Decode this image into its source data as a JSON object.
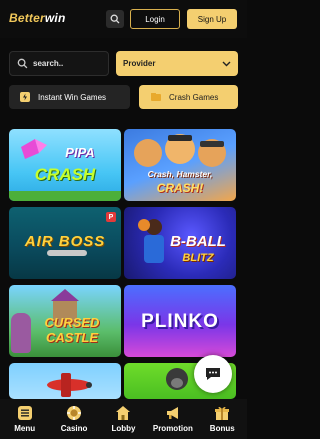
{
  "header": {
    "logo_part1": "Better",
    "logo_part2": "win",
    "login_label": "Login",
    "signup_label": "Sign Up"
  },
  "filters": {
    "search_placeholder": "search..",
    "provider_label": "Provider"
  },
  "categories": [
    {
      "label": "Instant Win Games",
      "active": false
    },
    {
      "label": "Crash Games",
      "active": true
    }
  ],
  "games": [
    {
      "title_line1": "PIPA",
      "title_line2": "CRASH"
    },
    {
      "title_line1": "Crash, Hamster,",
      "title_line2": "CRASH!"
    },
    {
      "title_line1": "AIR BOSS",
      "title_line2": "",
      "badge": "P"
    },
    {
      "title_line1": "B-BALL",
      "title_line2": "BLITZ"
    },
    {
      "title_line1": "CURSED",
      "title_line2": "CASTLE"
    },
    {
      "title_line1": "PLINKO",
      "title_line2": ""
    },
    {
      "title_line1": "",
      "title_line2": ""
    },
    {
      "title_line1": "",
      "title_line2": ""
    }
  ],
  "nav": [
    {
      "label": "Menu",
      "icon": "menu-icon"
    },
    {
      "label": "Casino",
      "icon": "casino-chip-icon"
    },
    {
      "label": "Lobby",
      "icon": "lobby-house-icon"
    },
    {
      "label": "Promotion",
      "icon": "megaphone-icon"
    },
    {
      "label": "Bonus",
      "icon": "gift-icon"
    }
  ],
  "colors": {
    "accent": "#f4cf70",
    "background": "#0b0b0b",
    "tab_inactive": "#242424"
  }
}
